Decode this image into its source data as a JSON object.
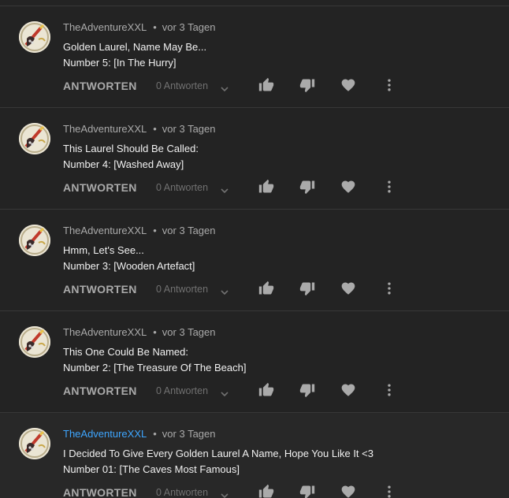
{
  "comments": [
    {
      "author": "TheAdventureXXL",
      "separator": "•",
      "time": "vor 3 Tagen",
      "line1": "Golden Laurel, Name May Be...",
      "line2": "Number 5: [In The Hurry]",
      "reply_label": "ANTWORTEN",
      "replies_label": "0 Antworten"
    },
    {
      "author": "TheAdventureXXL",
      "separator": "•",
      "time": "vor 3 Tagen",
      "line1": "This Laurel Should Be Called:",
      "line2": "Number 4: [Washed Away]",
      "reply_label": "ANTWORTEN",
      "replies_label": "0 Antworten"
    },
    {
      "author": "TheAdventureXXL",
      "separator": "•",
      "time": "vor 3 Tagen",
      "line1": "Hmm, Let's See...",
      "line2": "Number 3: [Wooden Artefact]",
      "reply_label": "ANTWORTEN",
      "replies_label": "0 Antworten"
    },
    {
      "author": "TheAdventureXXL",
      "separator": "•",
      "time": "vor 3 Tagen",
      "line1": "This One Could Be Named:",
      "line2": "Number 2: [The Treasure Of The Beach]",
      "reply_label": "ANTWORTEN",
      "replies_label": "0 Antworten"
    },
    {
      "author": "TheAdventureXXL",
      "separator": "•",
      "time": "vor 3 Tagen",
      "line1": "I Decided To Give Every Golden Laurel A Name, Hope You Like It <3",
      "line2": "Number 01: [The Caves Most Famous]",
      "reply_label": "ANTWORTEN",
      "replies_label": "0 Antworten",
      "author_highlighted": true
    }
  ],
  "icons": {
    "like": "thumbs-up-icon",
    "dislike": "thumbs-down-icon",
    "heart": "heart-icon",
    "more": "more-vert-icon",
    "expand": "chevron-down-icon"
  },
  "colors": {
    "background": "#232323",
    "text_primary": "#f1f1f1",
    "text_secondary": "#aaaaaa",
    "author_highlight": "#3ea6ff"
  }
}
